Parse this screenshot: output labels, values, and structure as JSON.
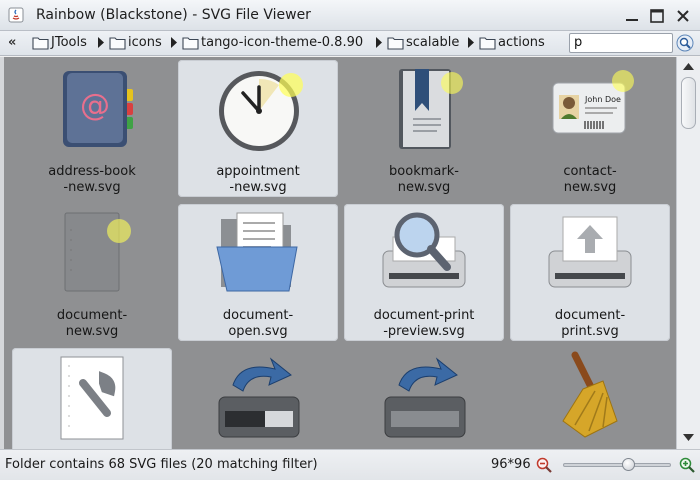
{
  "window": {
    "title": "Rainbow (Blackstone) - SVG File Viewer"
  },
  "pathbar": {
    "back_glyph": "«",
    "crumbs": [
      {
        "label": "JTools",
        "icon": "folder-icon"
      },
      {
        "label": "icons",
        "icon": "folder-icon"
      },
      {
        "label": "tango-icon-theme-0.8.90",
        "icon": "folder-icon"
      },
      {
        "label": "scalable",
        "icon": "folder-icon"
      },
      {
        "label": "actions",
        "icon": "folder-icon"
      }
    ],
    "filter_value": "p"
  },
  "grid": {
    "items": [
      {
        "label": "address-book\n-new.svg",
        "icon": "address-book-icon",
        "selected": false
      },
      {
        "label": "appointment\n-new.svg",
        "icon": "appointment-clock-icon",
        "selected": true
      },
      {
        "label": "bookmark-\nnew.svg",
        "icon": "bookmark-icon",
        "selected": false
      },
      {
        "label": "contact-\nnew.svg",
        "icon": "contact-card-icon",
        "selected": false
      },
      {
        "label": "document-\nnew.svg",
        "icon": "document-new-icon",
        "selected": false
      },
      {
        "label": "document-\nopen.svg",
        "icon": "document-open-folder-icon",
        "selected": true
      },
      {
        "label": "document-print\n-preview.svg",
        "icon": "print-preview-icon",
        "selected": true
      },
      {
        "label": "document-\nprint.svg",
        "icon": "printer-icon",
        "selected": true
      },
      {
        "label": "",
        "icon": "document-properties-icon",
        "selected": true
      },
      {
        "label": "",
        "icon": "drive-save-icon",
        "selected": false
      },
      {
        "label": "",
        "icon": "drive-save-as-icon",
        "selected": false
      },
      {
        "label": "",
        "icon": "broom-clear-icon",
        "selected": false
      }
    ]
  },
  "status": {
    "text": "Folder contains 68 SVG files (20 matching filter)",
    "size": "96*96",
    "zoom_fraction": 0.62
  }
}
